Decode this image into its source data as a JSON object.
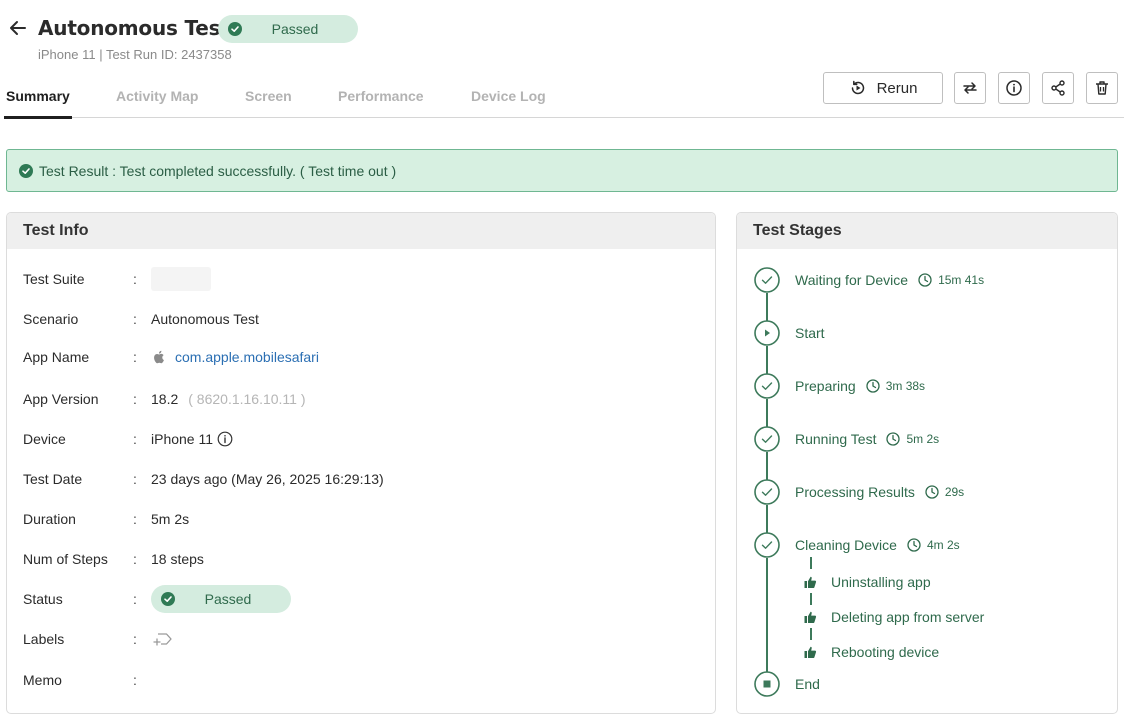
{
  "header": {
    "title": "Autonomous Test",
    "status": "Passed",
    "subtitle": "iPhone 11 | Test Run ID: 2437358"
  },
  "tabs": [
    {
      "label": "Summary",
      "active": true
    },
    {
      "label": "Activity Map",
      "active": false
    },
    {
      "label": "Screen",
      "active": false
    },
    {
      "label": "Performance",
      "active": false
    },
    {
      "label": "Device Log",
      "active": false
    }
  ],
  "toolbar": {
    "rerun_label": "Rerun"
  },
  "banner": {
    "text": "Test Result : Test completed successfully. ( Test time out )"
  },
  "test_info": {
    "title": "Test Info",
    "rows": {
      "test_suite": {
        "label": "Test Suite"
      },
      "scenario": {
        "label": "Scenario",
        "value": "Autonomous Test"
      },
      "app_name": {
        "label": "App Name",
        "value": "com.apple.mobilesafari"
      },
      "app_version": {
        "label": "App Version",
        "value": "18.2",
        "build": "( 8620.1.16.10.11 )"
      },
      "device": {
        "label": "Device",
        "value": "iPhone 11"
      },
      "test_date": {
        "label": "Test Date",
        "value": "23 days ago (May 26, 2025 16:29:13)"
      },
      "duration": {
        "label": "Duration",
        "value": "5m 2s"
      },
      "num_steps": {
        "label": "Num of Steps",
        "value": "18 steps"
      },
      "status": {
        "label": "Status",
        "value": "Passed"
      },
      "labels": {
        "label": "Labels"
      },
      "memo": {
        "label": "Memo"
      }
    },
    "colon": ":"
  },
  "test_stages": {
    "title": "Test Stages",
    "stages": [
      {
        "label": "Waiting for Device",
        "duration": "15m 41s"
      },
      {
        "label": "Start"
      },
      {
        "label": "Preparing",
        "duration": "3m 38s"
      },
      {
        "label": "Running Test",
        "duration": "5m 2s"
      },
      {
        "label": "Processing Results",
        "duration": "29s"
      },
      {
        "label": "Cleaning Device",
        "duration": "4m 2s"
      },
      {
        "label": "End"
      }
    ],
    "sub_steps": [
      {
        "label": "Uninstalling app"
      },
      {
        "label": "Deleting app from server"
      },
      {
        "label": "Rebooting device"
      }
    ]
  },
  "colors": {
    "accent_green": "#2f6a4c",
    "badge_bg": "#d4ecdf",
    "banner_bg": "#d7f0e1",
    "link": "#2b6fb3"
  }
}
